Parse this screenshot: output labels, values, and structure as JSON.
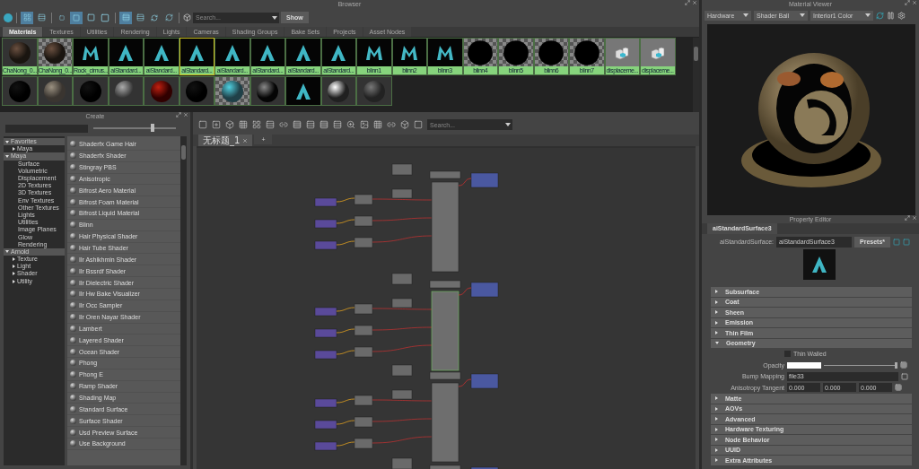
{
  "browser": {
    "title": "Browser",
    "toolbar": [
      {
        "kind": "grid",
        "selected": true
      },
      {
        "kind": "list",
        "selected": false
      },
      {
        "kind": "size-small",
        "selected": false
      },
      {
        "kind": "size-medium",
        "selected": true
      },
      {
        "kind": "size-large",
        "selected": false
      },
      {
        "kind": "size-xlarge",
        "selected": false
      },
      {
        "kind": "sort-name",
        "selected": true
      },
      {
        "kind": "sort-type",
        "selected": false
      },
      {
        "kind": "sort-time",
        "selected": false
      },
      {
        "kind": "reverse",
        "selected": false
      }
    ],
    "search": {
      "placeholder": "Search..."
    },
    "show_button": "Show",
    "tabs": [
      {
        "label": "Materials",
        "selected": true
      },
      {
        "label": "Textures",
        "selected": false
      },
      {
        "label": "Utilities",
        "selected": false
      },
      {
        "label": "Rendering",
        "selected": false
      },
      {
        "label": "Lights",
        "selected": false
      },
      {
        "label": "Cameras",
        "selected": false
      },
      {
        "label": "Shading Groups",
        "selected": false
      },
      {
        "label": "Bake Sets",
        "selected": false
      },
      {
        "label": "Projects",
        "selected": false
      },
      {
        "label": "Asset Nodes",
        "selected": false
      }
    ],
    "swatch_rows": [
      {
        "items": [
          {
            "label": "ChaNong_0...",
            "kind": "shaded-sphere",
            "selected": false
          },
          {
            "label": "ChaNong_0...",
            "kind": "checker-sphere",
            "selected": false
          },
          {
            "label": "Rock_cimus...",
            "kind": "maya",
            "selected": false
          },
          {
            "label": "aiStandard...",
            "kind": "arnold",
            "selected": false
          },
          {
            "label": "aiStandard...",
            "kind": "arnold",
            "selected": false
          },
          {
            "label": "aiStandard...",
            "kind": "arnold",
            "selected": true
          },
          {
            "label": "aiStandard...",
            "kind": "arnold",
            "selected": false
          },
          {
            "label": "aiStandard...",
            "kind": "arnold",
            "selected": false
          },
          {
            "label": "aiStandard...",
            "kind": "arnold",
            "selected": false
          },
          {
            "label": "aiStandard...",
            "kind": "arnold",
            "selected": false
          },
          {
            "label": "blinn1",
            "kind": "maya",
            "selected": false
          },
          {
            "label": "blinn2",
            "kind": "maya",
            "selected": false
          },
          {
            "label": "blinn3",
            "kind": "maya",
            "selected": false
          },
          {
            "label": "blinn4",
            "kind": "checker-black",
            "selected": false
          },
          {
            "label": "blinn5",
            "kind": "checker-black",
            "selected": false
          },
          {
            "label": "blinn6",
            "kind": "checker-black",
            "selected": false
          },
          {
            "label": "blinn7",
            "kind": "checker-black",
            "selected": false
          },
          {
            "label": "displaceme...",
            "kind": "displacement",
            "selected": false
          },
          {
            "label": "displaceme...",
            "kind": "displacement",
            "selected": false
          }
        ]
      },
      {
        "items": [
          {
            "kind": "black",
            "selected": false
          },
          {
            "kind": "stone",
            "selected": false
          },
          {
            "kind": "black",
            "selected": false
          },
          {
            "kind": "grey",
            "selected": false
          },
          {
            "kind": "red",
            "selected": false
          },
          {
            "kind": "black",
            "selected": false
          },
          {
            "kind": "checker-glow",
            "selected": false
          },
          {
            "kind": "glossy",
            "selected": false
          },
          {
            "kind": "arnold",
            "selected": false
          },
          {
            "kind": "chrome",
            "selected": false
          },
          {
            "kind": "grey-dark",
            "selected": false
          }
        ]
      }
    ]
  },
  "create": {
    "title": "Create",
    "slider": {
      "level": 0.72
    },
    "tree": [
      {
        "label": "Favorites",
        "expanded": true,
        "children": [
          {
            "label": "Maya",
            "expanded": false
          }
        ]
      },
      {
        "label": "Maya",
        "expanded": true,
        "children": [
          {
            "label": "Surface"
          },
          {
            "label": "Volumetric"
          },
          {
            "label": "Displacement"
          },
          {
            "label": "2D Textures"
          },
          {
            "label": "3D Textures"
          },
          {
            "label": "Env Textures"
          },
          {
            "label": "Other Textures"
          },
          {
            "label": "Lights"
          },
          {
            "label": "Utilities"
          },
          {
            "label": "Image Planes"
          },
          {
            "label": "Glow"
          },
          {
            "label": "Rendering"
          }
        ]
      },
      {
        "label": "Arnold",
        "expanded": true,
        "children": [
          {
            "label": "Texture",
            "expanded": false
          },
          {
            "label": "Light",
            "expanded": false
          },
          {
            "label": "Shader",
            "expanded": false
          },
          {
            "label": "Utility",
            "expanded": false
          }
        ]
      }
    ],
    "items": [
      "Shaderfx Game Hair",
      "Shaderfx Shader",
      "Stingray PBS",
      "Anisotropic",
      "Bifrost Aero Material",
      "Bifrost Foam Material",
      "Bifrost Liquid Material",
      "Blinn",
      "Hair Physical Shader",
      "Hair Tube Shader",
      "Ilr Ashikhmin Shader",
      "Ilr Bssrdf Shader",
      "Ilr Dielectric Shader",
      "Ilr Hw Bake Visualizer",
      "Ilr Occ Sampler",
      "Ilr Oren Nayar Shader",
      "Lambert",
      "Layered Shader",
      "Ocean Shader",
      "Phong",
      "Phong E",
      "Ramp Shader",
      "Shading Map",
      "Standard Surface",
      "Surface Shader",
      "Usd Preview Surface",
      "Use Background"
    ]
  },
  "node_editor": {
    "search": {
      "placeholder": "Search..."
    },
    "tabs": [
      {
        "label": "无标题_1",
        "selected": true
      }
    ],
    "add_tab": "+"
  },
  "material_viewer": {
    "title": "Material Viewer",
    "renderer": "Hardware",
    "geometry": "Shader Ball",
    "lighting": "Interior1 Color"
  },
  "property_editor": {
    "title": "Property Editor",
    "tab": "aiStandardSurface3",
    "type_label": "aiStandardSurface:",
    "name_value": "aiStandardSurface3",
    "presets": "Presets*",
    "sections": [
      {
        "label": "Subsurface",
        "expanded": false
      },
      {
        "label": "Coat",
        "expanded": false
      },
      {
        "label": "Sheen",
        "expanded": false
      },
      {
        "label": "Emission",
        "expanded": false
      },
      {
        "label": "Thin Film",
        "expanded": false
      },
      {
        "label": "Geometry",
        "expanded": true,
        "attributes": [
          {
            "kind": "checkbox",
            "label": "Thin Walled",
            "checked": false
          },
          {
            "kind": "color-slider",
            "label": "Opacity",
            "level": 0.98
          },
          {
            "kind": "texture-field",
            "label": "Bump Mapping",
            "value": "file33"
          },
          {
            "kind": "vector",
            "label": "Anisotropy Tangent",
            "values": [
              "0.000",
              "0.000",
              "0.000"
            ]
          }
        ]
      },
      {
        "label": "Matte",
        "expanded": false
      },
      {
        "label": "AOVs",
        "expanded": false
      },
      {
        "label": "Advanced",
        "expanded": false
      },
      {
        "label": "Hardware Texturing",
        "expanded": false
      },
      {
        "label": "Node Behavior",
        "expanded": false
      },
      {
        "label": "UUID",
        "expanded": false
      },
      {
        "label": "Extra Attributes",
        "expanded": false
      }
    ]
  }
}
